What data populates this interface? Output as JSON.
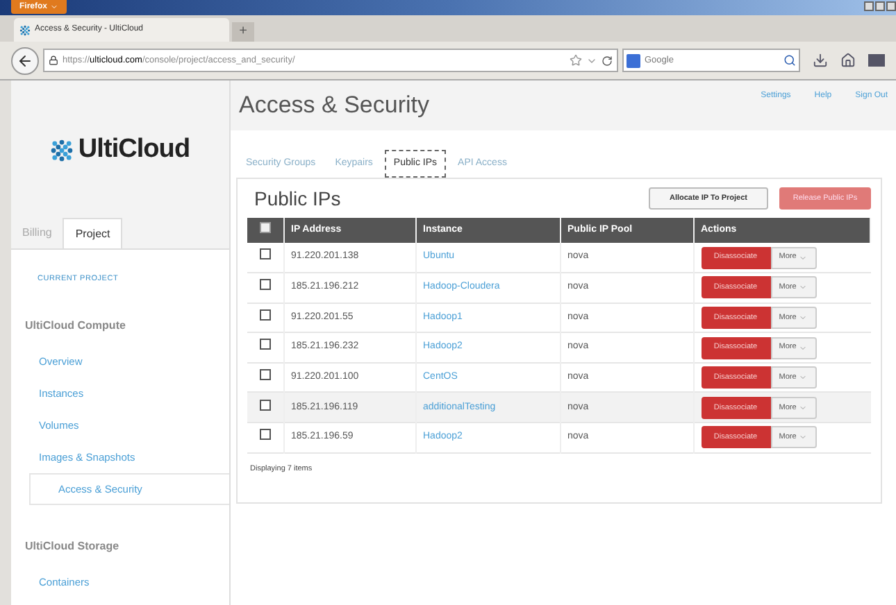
{
  "browser": {
    "menu_button": "Firefox",
    "tab_title": "Access & Security - UltiCloud",
    "new_tab": "+",
    "url_prefix": "https://",
    "url_domain": "ulticloud.com",
    "url_path": "/console/project/access_and_security/",
    "search_placeholder": "Google"
  },
  "sidebar": {
    "logo": "UltiCloud",
    "tabs": [
      {
        "label": "Billing",
        "selected": false
      },
      {
        "label": "Project",
        "selected": true
      }
    ],
    "current_project": "CURRENT PROJECT",
    "sections": [
      {
        "title": "UltiCloud Compute",
        "items": [
          {
            "label": "Overview",
            "selected": false
          },
          {
            "label": "Instances",
            "selected": false
          },
          {
            "label": "Volumes",
            "selected": false
          },
          {
            "label": "Images & Snapshots",
            "selected": false
          },
          {
            "label": "Access & Security",
            "selected": true
          }
        ]
      },
      {
        "title": "UltiCloud Storage",
        "items": [
          {
            "label": "Containers",
            "selected": false
          }
        ]
      }
    ]
  },
  "header": {
    "title": "Access & Security",
    "links": [
      "Settings",
      "Help",
      "Sign Out"
    ]
  },
  "tabs": [
    {
      "label": "Security Groups",
      "selected": false
    },
    {
      "label": "Keypairs",
      "selected": false
    },
    {
      "label": "Public IPs",
      "selected": true
    },
    {
      "label": "API Access",
      "selected": false
    }
  ],
  "panel": {
    "title": "Public IPs",
    "buttons": [
      {
        "label": "Allocate IP To Project",
        "kind": "default"
      },
      {
        "label": "Release Public IPs",
        "kind": "danger"
      }
    ]
  },
  "table": {
    "select_all_checked": false,
    "columns": [
      "IP Address",
      "Instance",
      "Public IP Pool",
      "Actions"
    ],
    "rows": [
      {
        "checked": false,
        "highlighted": false,
        "ip": "91.220.201.138",
        "instance": "Ubuntu",
        "pool": "nova",
        "action": "Disassociate",
        "more": "More"
      },
      {
        "checked": false,
        "highlighted": false,
        "ip": "185.21.196.212",
        "instance": "Hadoop-Cloudera",
        "pool": "nova",
        "action": "Disassociate",
        "more": "More"
      },
      {
        "checked": false,
        "highlighted": false,
        "ip": "91.220.201.55",
        "instance": "Hadoop1",
        "pool": "nova",
        "action": "Disassociate",
        "more": "More"
      },
      {
        "checked": false,
        "highlighted": false,
        "ip": "185.21.196.232",
        "instance": "Hadoop2",
        "pool": "nova",
        "action": "Disassociate",
        "more": "More"
      },
      {
        "checked": false,
        "highlighted": false,
        "ip": "91.220.201.100",
        "instance": "CentOS",
        "pool": "nova",
        "action": "Disassociate",
        "more": "More"
      },
      {
        "checked": false,
        "highlighted": true,
        "ip": "185.21.196.119",
        "instance": "additionalTesting",
        "pool": "nova",
        "action": "Disassociate",
        "more": "More"
      },
      {
        "checked": false,
        "highlighted": false,
        "ip": "185.21.196.59",
        "instance": "Hadoop2",
        "pool": "nova",
        "action": "Disassociate",
        "more": "More"
      }
    ],
    "footer": "Displaying 7 items"
  }
}
